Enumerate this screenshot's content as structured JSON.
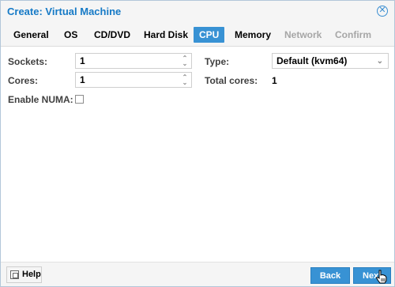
{
  "window": {
    "title": "Create: Virtual Machine"
  },
  "tabs": [
    {
      "label": "General",
      "state": "normal"
    },
    {
      "label": "OS",
      "state": "normal"
    },
    {
      "label": "CD/DVD",
      "state": "normal"
    },
    {
      "label": "Hard Disk",
      "state": "normal"
    },
    {
      "label": "CPU",
      "state": "active"
    },
    {
      "label": "Memory",
      "state": "normal"
    },
    {
      "label": "Network",
      "state": "disabled"
    },
    {
      "label": "Confirm",
      "state": "disabled"
    }
  ],
  "cpu": {
    "sockets_label": "Sockets:",
    "sockets_value": "1",
    "cores_label": "Cores:",
    "cores_value": "1",
    "numa_label": "Enable NUMA:",
    "numa_checked": false,
    "type_label": "Type:",
    "type_value": "Default (kvm64)",
    "total_cores_label": "Total cores:",
    "total_cores_value": "1"
  },
  "footer": {
    "help_label": "Help",
    "back_label": "Back",
    "next_label": "Next"
  },
  "colors": {
    "accent": "#3892d4",
    "title": "#167ac6",
    "disabled_tab": "#a6a6a6"
  }
}
